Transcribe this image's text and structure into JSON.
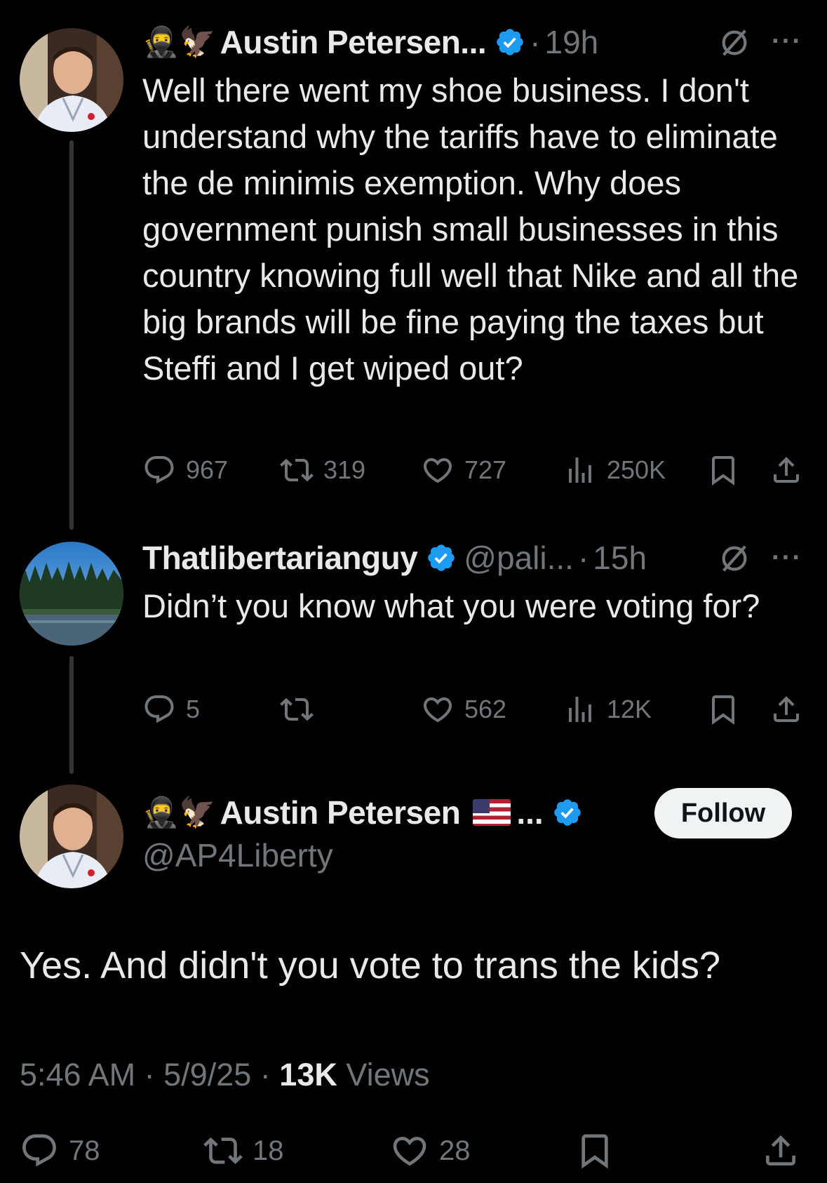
{
  "tweets": [
    {
      "emoji": "🥷🦅",
      "name": "Austin Petersen...",
      "separator": "·",
      "time": "19h",
      "more": "···",
      "text": "Well there went my shoe business. I don't understand why the tariffs have to eliminate the de minimis exemption. Why does government punish small businesses in this country knowing full well that Nike and all the big brands will be fine paying the taxes but Steffi and I get wiped out?",
      "replies": "967",
      "reposts": "319",
      "likes": "727",
      "views": "250K"
    },
    {
      "name": "Thatlibertarianguy",
      "handle": "@pali...",
      "separator": "·",
      "time": "15h",
      "more": "···",
      "text": "Didn’t you know what you were voting for?",
      "replies": "5",
      "reposts": "",
      "likes": "562",
      "views": "12K"
    }
  ],
  "main_tweet": {
    "emoji": "🥷🦅",
    "name": "Austin Petersen",
    "ellipsis": "...",
    "handle": "@AP4Liberty",
    "follow_label": "Follow",
    "text": "Yes. And didn't you vote to trans the kids?",
    "time": "5:46 AM",
    "separator": "·",
    "date": "5/9/25",
    "views_count": "13K",
    "views_label": "Views",
    "replies": "78",
    "reposts": "18",
    "likes": "28"
  },
  "colors": {
    "background": "#000000",
    "text": "#e7e9ea",
    "muted": "#71767b",
    "verified": "#1d9bf0"
  }
}
